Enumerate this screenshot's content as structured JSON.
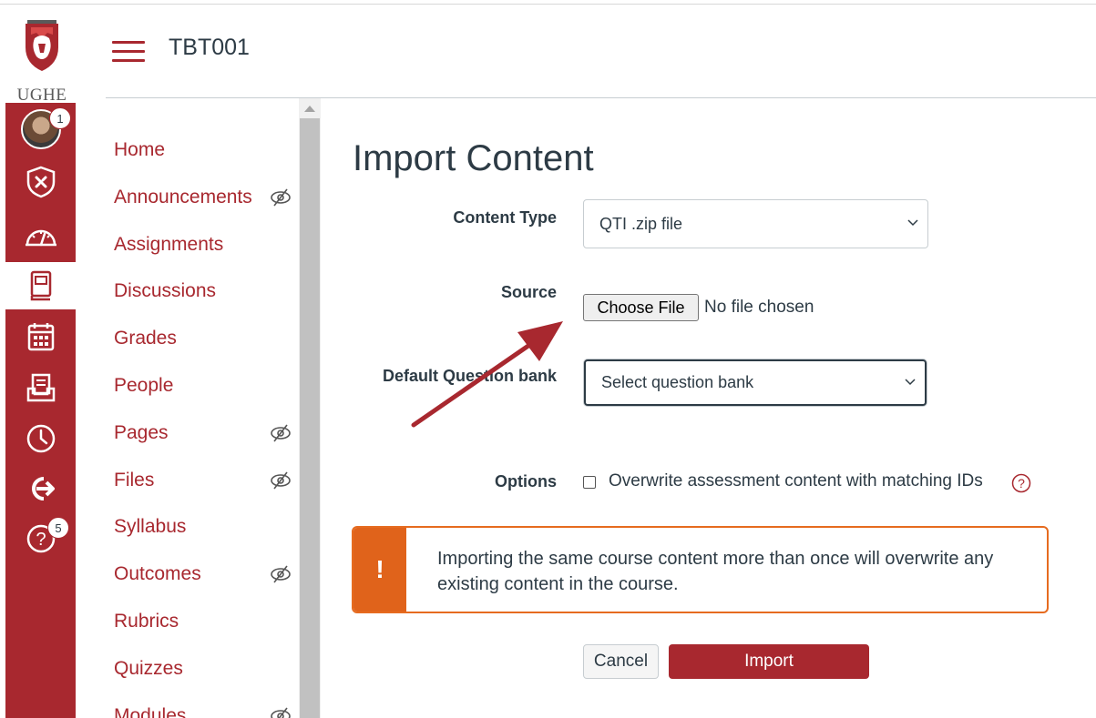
{
  "logo": {
    "text": "UGHE"
  },
  "global_nav": {
    "account_badge": "1",
    "help_badge": "5",
    "items": [
      {
        "icon": "avatar"
      },
      {
        "icon": "shield-icon"
      },
      {
        "icon": "dashboard-icon"
      },
      {
        "icon": "courses-icon",
        "active": true
      },
      {
        "icon": "calendar-icon"
      },
      {
        "icon": "inbox-icon"
      },
      {
        "icon": "history-icon"
      },
      {
        "icon": "logout-icon"
      },
      {
        "icon": "help-icon"
      }
    ]
  },
  "header": {
    "course_code": "TBT001"
  },
  "course_nav": {
    "items": [
      {
        "label": "Home",
        "hidden": false
      },
      {
        "label": "Announcements",
        "hidden": true
      },
      {
        "label": "Assignments",
        "hidden": false
      },
      {
        "label": "Discussions",
        "hidden": false
      },
      {
        "label": "Grades",
        "hidden": false
      },
      {
        "label": "People",
        "hidden": false
      },
      {
        "label": "Pages",
        "hidden": true
      },
      {
        "label": "Files",
        "hidden": true
      },
      {
        "label": "Syllabus",
        "hidden": false
      },
      {
        "label": "Outcomes",
        "hidden": true
      },
      {
        "label": "Rubrics",
        "hidden": false
      },
      {
        "label": "Quizzes",
        "hidden": false
      },
      {
        "label": "Modules",
        "hidden": true
      }
    ]
  },
  "main": {
    "title": "Import Content",
    "content_type": {
      "label": "Content Type",
      "value": "QTI .zip file"
    },
    "source": {
      "label": "Source",
      "button": "Choose File",
      "status": "No file chosen"
    },
    "question_bank": {
      "label": "Default Question bank",
      "value": "Select question bank"
    },
    "options": {
      "label": "Options",
      "checkbox_label": "Overwrite assessment content with matching IDs",
      "checked": false
    },
    "alert": {
      "icon": "!",
      "text": "Importing the same course content more than once will overwrite any existing content in the course."
    },
    "buttons": {
      "cancel": "Cancel",
      "import": "Import"
    }
  },
  "colors": {
    "brand": "#a8282f",
    "warning": "#e0631b",
    "text": "#2d3b45"
  }
}
